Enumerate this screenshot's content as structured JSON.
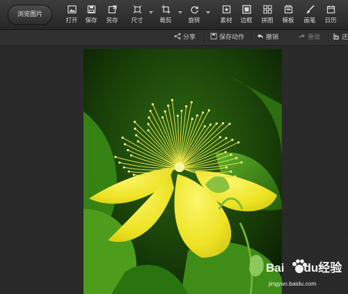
{
  "toolbar": {
    "browse_label": "浏览图片",
    "tools": [
      {
        "id": "open",
        "label": "打开",
        "icon": "open-image-icon",
        "dropdown": false
      },
      {
        "id": "save",
        "label": "保存",
        "icon": "save-icon",
        "dropdown": false
      },
      {
        "id": "saveas",
        "label": "另存",
        "icon": "save-as-icon",
        "dropdown": false
      },
      {
        "id": "size",
        "label": "尺寸",
        "icon": "resize-icon",
        "dropdown": true
      },
      {
        "id": "crop",
        "label": "裁剪",
        "icon": "crop-icon",
        "dropdown": true
      },
      {
        "id": "rotate",
        "label": "旋转",
        "icon": "rotate-icon",
        "dropdown": true
      },
      {
        "id": "material",
        "label": "素材",
        "icon": "material-icon",
        "dropdown": false
      },
      {
        "id": "border",
        "label": "边框",
        "icon": "border-icon",
        "dropdown": false
      },
      {
        "id": "collage",
        "label": "拼图",
        "icon": "collage-icon",
        "dropdown": false
      },
      {
        "id": "template",
        "label": "模板",
        "icon": "template-icon",
        "dropdown": false
      },
      {
        "id": "brush",
        "label": "画笔",
        "icon": "brush-icon",
        "dropdown": false
      },
      {
        "id": "calendar",
        "label": "日历",
        "icon": "calendar-icon",
        "dropdown": false
      }
    ]
  },
  "subbar": {
    "share_label": "分享",
    "save_action_label": "保存动作",
    "undo_label": "撤销",
    "redo_label": "重做",
    "more_label": "还"
  },
  "watermark": {
    "brand": "Baidu经验",
    "url": "jingyan.baidu.com"
  },
  "colors": {
    "toolbar_bg": "#333333",
    "canvas_bg": "#282828",
    "text": "#d8d8d8",
    "disabled_text": "#777777",
    "flower_yellow": "#f3ec2a",
    "leaf_green": "#3c8a14"
  }
}
